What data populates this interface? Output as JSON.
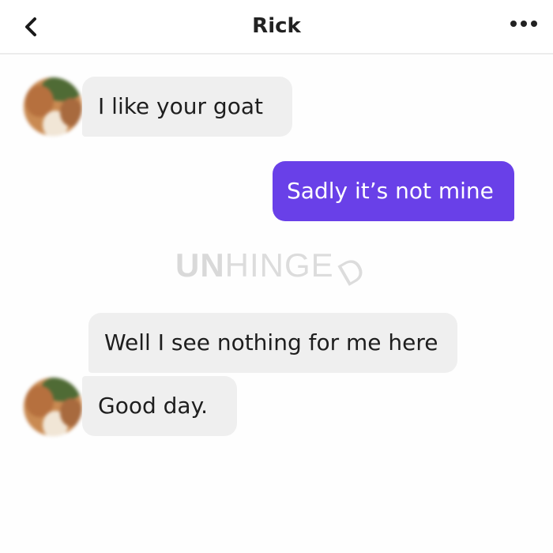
{
  "header": {
    "title": "Rick",
    "back_icon": "chevron-left-icon",
    "more_icon": "more-horizontal-icon"
  },
  "messages": [
    {
      "direction": "incoming",
      "text": "I like your goat"
    },
    {
      "direction": "outgoing",
      "text": "Sadly it’s not mine"
    },
    {
      "direction": "incoming",
      "text": "Well I see nothing for me here"
    },
    {
      "direction": "incoming",
      "text": "Good day."
    }
  ],
  "watermark": {
    "bold_part": "UN",
    "light_part": "HINGE",
    "tail_part": "D"
  },
  "colors": {
    "outgoing_bubble": "#6940e8",
    "incoming_bubble": "#efefef"
  }
}
